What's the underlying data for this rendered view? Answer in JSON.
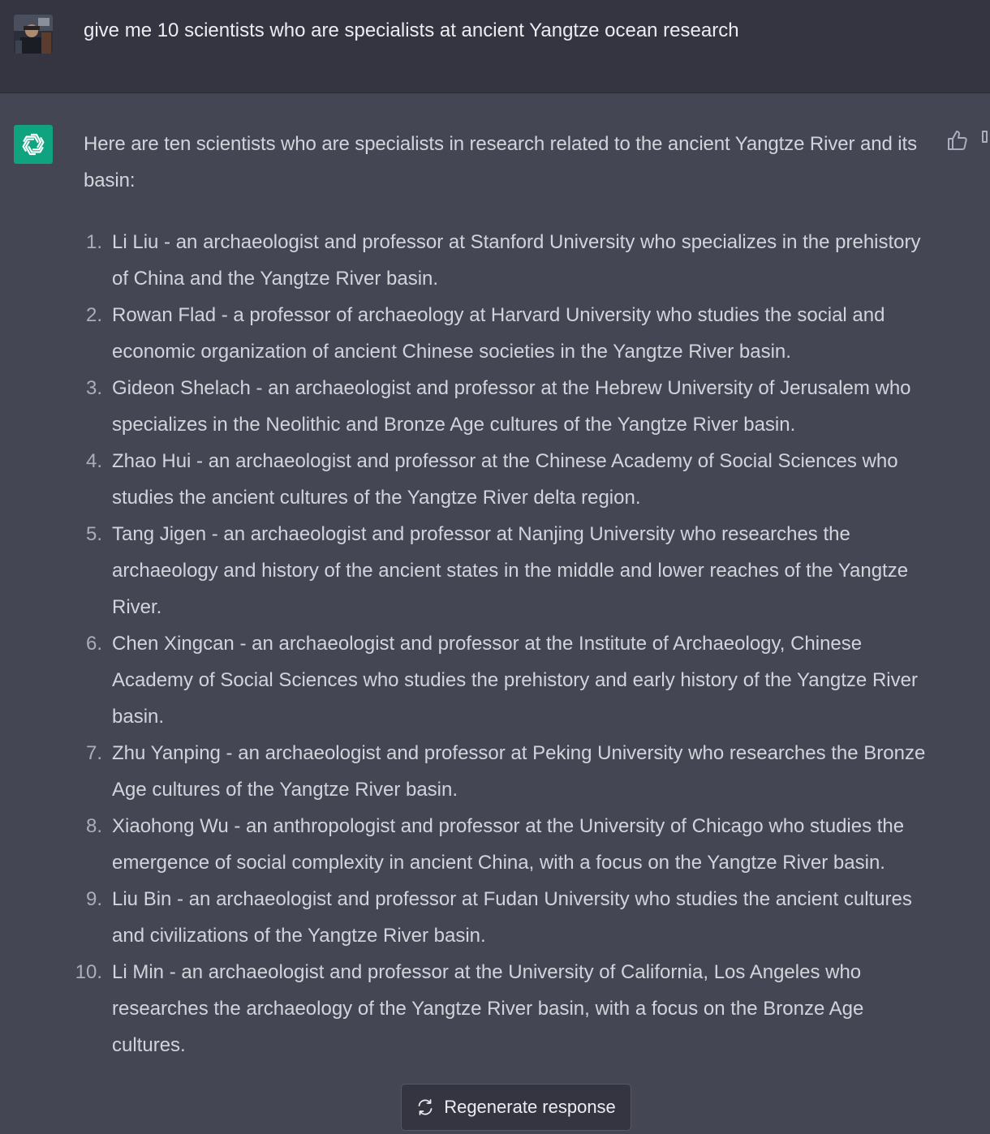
{
  "user_message": {
    "avatar": "user-avatar-photo",
    "text": "give me 10 scientists who are specialists at ancient Yangtze ocean research"
  },
  "assistant_message": {
    "avatar": "chatgpt-logo-icon",
    "intro": "Here are ten scientists who are specialists in research related to the ancient Yangtze River and its basin:",
    "items": [
      {
        "num": "1.",
        "text": "Li Liu - an archaeologist and professor at Stanford University who specializes in the prehistory of China and the Yangtze River basin."
      },
      {
        "num": "2.",
        "text": "Rowan Flad - a professor of archaeology at Harvard University who studies the social and economic organization of ancient Chinese societies in the Yangtze River basin."
      },
      {
        "num": "3.",
        "text": "Gideon Shelach - an archaeologist and professor at the Hebrew University of Jerusalem who specializes in the Neolithic and Bronze Age cultures of the Yangtze River basin."
      },
      {
        "num": "4.",
        "text": "Zhao Hui - an archaeologist and professor at the Chinese Academy of Social Sciences who studies the ancient cultures of the Yangtze River delta region."
      },
      {
        "num": "5.",
        "text": "Tang Jigen - an archaeologist and professor at Nanjing University who researches the archaeology and history of the ancient states in the middle and lower reaches of the Yangtze River."
      },
      {
        "num": "6.",
        "text": "Chen Xingcan - an archaeologist and professor at the Institute of Archaeology, Chinese Academy of Social Sciences who studies the prehistory and early history of the Yangtze River basin."
      },
      {
        "num": "7.",
        "text": "Zhu Yanping - an archaeologist and professor at Peking University who researches the Bronze Age cultures of the Yangtze River basin."
      },
      {
        "num": "8.",
        "text": "Xiaohong Wu - an anthropologist and professor at the University of Chicago who studies the emergence of social complexity in ancient China, with a focus on the Yangtze River basin."
      },
      {
        "num": "9.",
        "text": "Liu Bin - an archaeologist and professor at Fudan University who studies the ancient cultures and civilizations of the Yangtze River basin."
      },
      {
        "num": "10.",
        "text": "Li Min - an archaeologist and professor at the University of California, Los Angeles who researches the archaeology of the Yangtze River basin, with a focus on the Bronze Age cultures."
      }
    ]
  },
  "feedback": {
    "thumbs_up_icon": "thumbs-up-icon",
    "thumbs_down_icon": "thumbs-down-icon"
  },
  "regenerate": {
    "label": "Regenerate response",
    "icon": "refresh-icon"
  },
  "colors": {
    "user_row_bg": "#343541",
    "assistant_row_bg": "#444654",
    "brand_green": "#10a37f",
    "text": "#d1d5db"
  }
}
